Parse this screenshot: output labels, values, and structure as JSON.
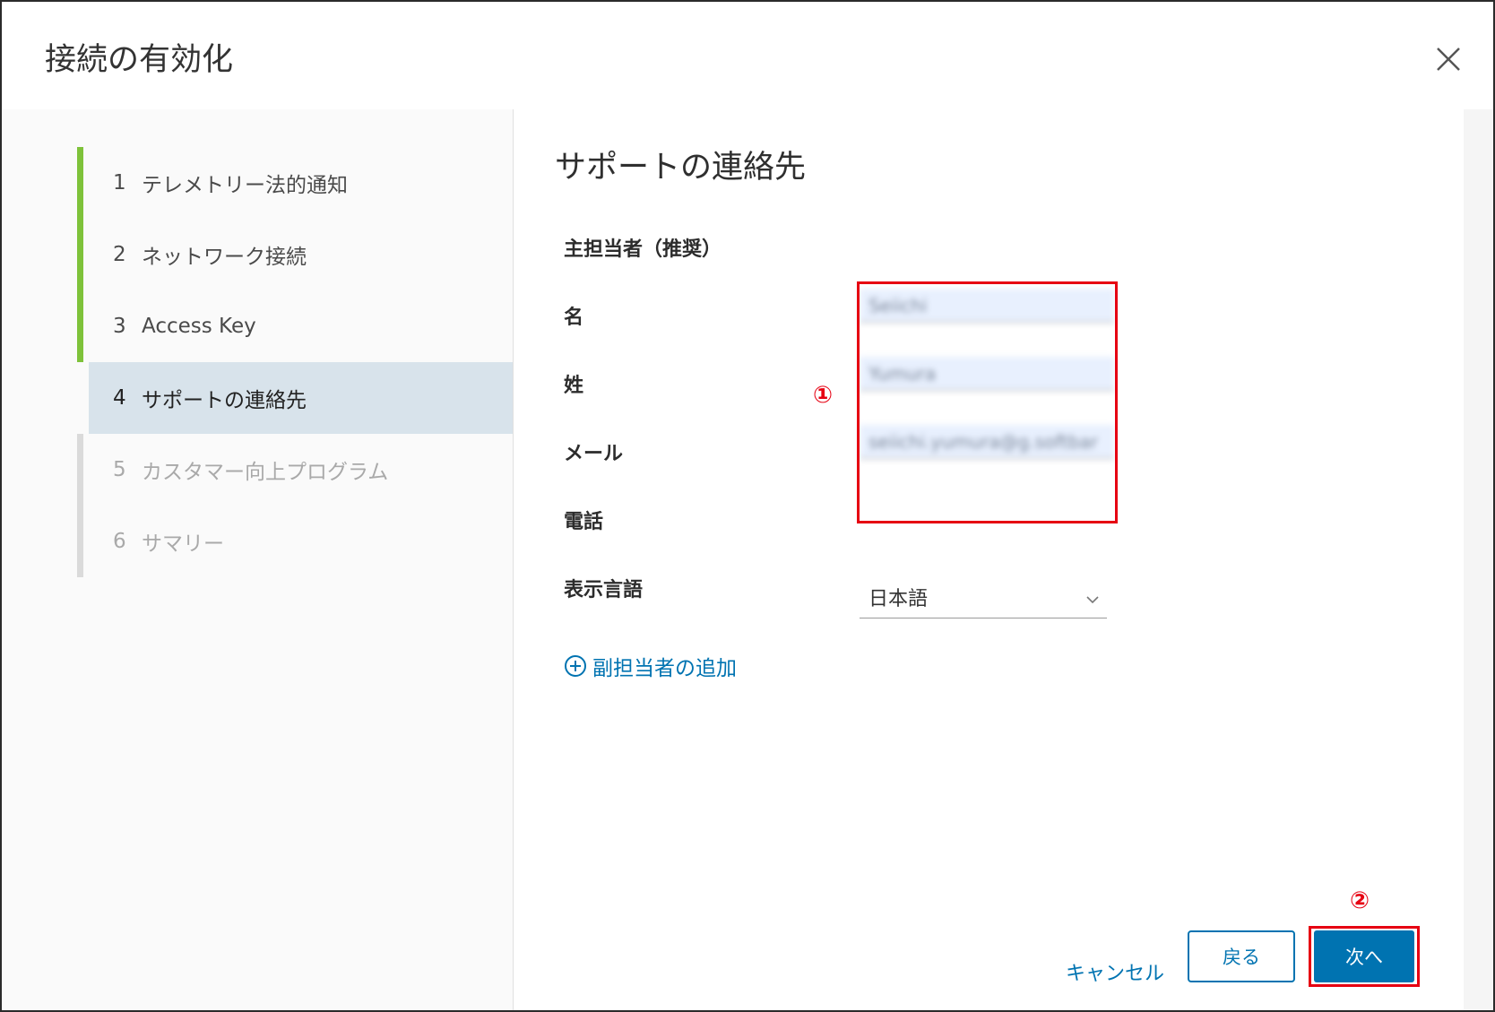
{
  "dialog": {
    "title": "接続の有効化",
    "close_icon": "close-icon"
  },
  "sidebar": {
    "steps": [
      {
        "num": "1",
        "label": "テレメトリー法的通知",
        "state": "done"
      },
      {
        "num": "2",
        "label": "ネットワーク接続",
        "state": "done"
      },
      {
        "num": "3",
        "label": "Access Key",
        "state": "done"
      },
      {
        "num": "4",
        "label": "サポートの連絡先",
        "state": "active"
      },
      {
        "num": "5",
        "label": "カスタマー向上プログラム",
        "state": "future"
      },
      {
        "num": "6",
        "label": "サマリー",
        "state": "future"
      }
    ]
  },
  "main": {
    "section_title": "サポートの連絡先",
    "primary_heading": "主担当者（推奨）",
    "fields": {
      "first_name_label": "名",
      "first_name_value": "Seiichi",
      "last_name_label": "姓",
      "last_name_value": "Yumura",
      "email_label": "メール",
      "email_value": "seiichi.yumura@g.softbar",
      "phone_label": "電話",
      "phone_value": ""
    },
    "language_label": "表示言語",
    "language_value": "日本語",
    "add_secondary": "副担当者の追加"
  },
  "footer": {
    "cancel": "キャンセル",
    "back": "戻る",
    "next": "次へ"
  },
  "annotations": {
    "fields_marker": "①",
    "next_marker": "②",
    "color": "#e60012"
  },
  "colors": {
    "accent": "#0073b1",
    "step_done": "#7ec23a",
    "active_step_bg": "#d8e3eb"
  }
}
